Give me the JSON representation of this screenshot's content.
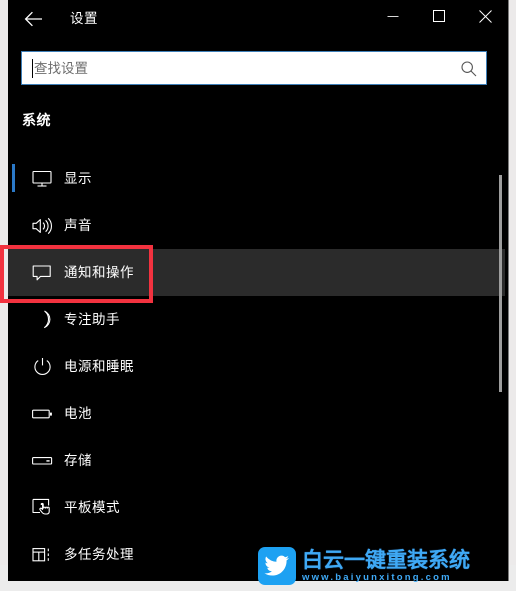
{
  "window": {
    "title": "设置",
    "back_icon": "back-arrow-icon",
    "controls": {
      "minimize": "minimize-icon",
      "maximize": "maximize-icon",
      "close": "close-icon"
    }
  },
  "search": {
    "placeholder": "查找设置",
    "value": "",
    "icon": "search-icon"
  },
  "section": {
    "title": "系统"
  },
  "nav": {
    "items": [
      {
        "label": "显示",
        "icon": "monitor-icon",
        "selected": true,
        "hovered": false
      },
      {
        "label": "声音",
        "icon": "speaker-icon",
        "selected": false,
        "hovered": false
      },
      {
        "label": "通知和操作",
        "icon": "chat-bubble-icon",
        "selected": false,
        "hovered": true
      },
      {
        "label": "专注助手",
        "icon": "moon-icon",
        "selected": false,
        "hovered": false
      },
      {
        "label": "电源和睡眠",
        "icon": "power-icon",
        "selected": false,
        "hovered": false
      },
      {
        "label": "电池",
        "icon": "battery-icon",
        "selected": false,
        "hovered": false
      },
      {
        "label": "存储",
        "icon": "storage-icon",
        "selected": false,
        "hovered": false
      },
      {
        "label": "平板模式",
        "icon": "tablet-hand-icon",
        "selected": false,
        "hovered": false
      },
      {
        "label": "多任务处理",
        "icon": "multitasking-icon",
        "selected": false,
        "hovered": false
      }
    ]
  },
  "annotation": {
    "target_label": "通知和操作",
    "color": "#f2323f"
  },
  "scrollbar": {
    "orientation": "vertical"
  },
  "watermark": {
    "brand": "白云一键重装系统",
    "url": "www.baiyunxitong.com",
    "icon": "bird-icon",
    "color": "#3fa9f5",
    "badge_color": "#1da1f2"
  },
  "colors": {
    "accent": "#2b79c8",
    "window_background": "#000000",
    "hover_background": "#2b2b2b",
    "search_border": "#3e7fb8",
    "annotation": "#f2323f"
  }
}
